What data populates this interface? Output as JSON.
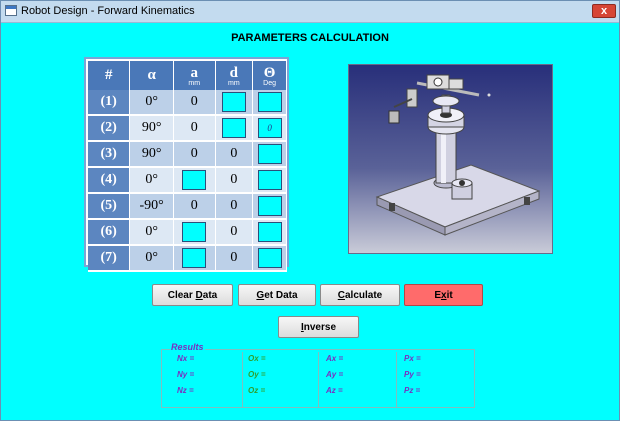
{
  "window": {
    "title": "Robot Design - Forward Kinematics",
    "close_label": "x"
  },
  "heading": "PARAMETERS CALCULATION",
  "table": {
    "headers": [
      {
        "symbol": "#",
        "unit": ""
      },
      {
        "symbol": "α",
        "unit": ""
      },
      {
        "symbol": "a",
        "unit": "mm"
      },
      {
        "symbol": "d",
        "unit": "mm"
      },
      {
        "symbol": "Θ",
        "unit": "Deg"
      }
    ],
    "rows": [
      {
        "index": "(1)",
        "alpha": "0°",
        "a": "0",
        "d": "",
        "theta": ""
      },
      {
        "index": "(2)",
        "alpha": "90°",
        "a": "0",
        "d": "",
        "theta": "0"
      },
      {
        "index": "(3)",
        "alpha": "90°",
        "a": "0",
        "d": "0",
        "theta": ""
      },
      {
        "index": "(4)",
        "alpha": "0°",
        "a": "",
        "d": "0",
        "theta": ""
      },
      {
        "index": "(5)",
        "alpha": "-90°",
        "a": "0",
        "d": "0",
        "theta": ""
      },
      {
        "index": "(6)",
        "alpha": "0°",
        "a": "",
        "d": "0",
        "theta": ""
      },
      {
        "index": "(7)",
        "alpha": "0°",
        "a": "",
        "d": "0",
        "theta": ""
      }
    ]
  },
  "buttons": {
    "clear_data": {
      "mnemonic": "",
      "rest": "Clear ",
      "key": "D",
      "tail": "ata"
    },
    "get_data": {
      "key": "G",
      "tail": "et Data"
    },
    "calculate": {
      "key": "C",
      "tail": "alculate"
    },
    "exit": {
      "head": "E",
      "key": "x",
      "tail": "it"
    },
    "inverse": {
      "key": "I",
      "tail": "nverse"
    }
  },
  "results": {
    "legend": "Results",
    "columns": [
      {
        "labels": [
          "Nx =",
          "Ny =",
          "Nz ="
        ],
        "color": "#7a2fbf"
      },
      {
        "labels": [
          "Ox =",
          "Oy =",
          "Oz ="
        ],
        "color": "#2fa02f"
      },
      {
        "labels": [
          "Ax =",
          "Ay =",
          "Az ="
        ],
        "color": "#7a2fbf"
      },
      {
        "labels": [
          "Px =",
          "Py =",
          "Pz ="
        ],
        "color": "#7a2fbf"
      }
    ]
  },
  "colors": {
    "background": "#00ffff",
    "header_blue": "#4a78b8",
    "exit_red": "#ff6b6b"
  }
}
